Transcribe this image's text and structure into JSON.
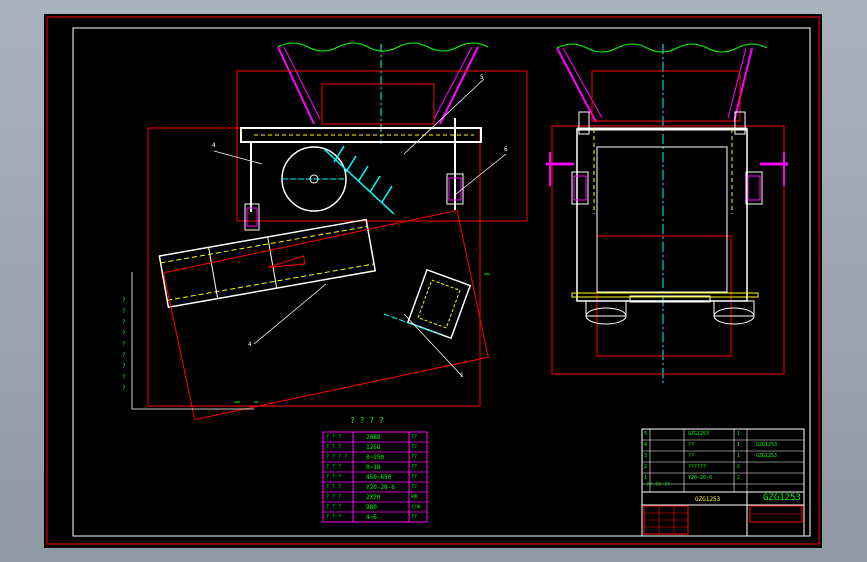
{
  "drawing": {
    "title_block_code": "GZG1253",
    "title_block_code2": "GZG1253",
    "name_cell": "GZG1253",
    "spec_heading": "? ? ? ?",
    "callouts": [
      "4",
      "5",
      "6",
      "4",
      "1"
    ]
  },
  "spec_table": {
    "rows": [
      {
        "label": "? ? ?",
        "value": "2088",
        "unit": "??"
      },
      {
        "label": "? ? ?",
        "value": "1250",
        "unit": "??"
      },
      {
        "label": "? ? ? ?",
        "value": "0~250",
        "unit": "??"
      },
      {
        "label": "? ? ?",
        "value": "0~18",
        "unit": "??"
      },
      {
        "label": "? ? ?",
        "value": "450~650",
        "unit": "??"
      },
      {
        "label": "? ? ?",
        "value": "Y20-20-6",
        "unit": "??"
      },
      {
        "label": "? ? ?",
        "value": "2X70",
        "unit": "kW"
      },
      {
        "label": "? ? ?",
        "value": "980",
        "unit": "r/m"
      },
      {
        "label": "? ? ?",
        "value": "4~6",
        "unit": "??"
      }
    ]
  },
  "bom_table": {
    "rows": [
      {
        "no": "5",
        "name": "GZG1253",
        "qty": "1",
        "code": ""
      },
      {
        "no": "4",
        "name": "??",
        "qty": "1",
        "code": "GZG1253"
      },
      {
        "no": "3",
        "name": "??",
        "qty": "1",
        "code": "GZG1253"
      },
      {
        "no": "2",
        "name": "??????",
        "qty": "2",
        "code": ""
      },
      {
        "no": "1",
        "name": "Y20-20-6",
        "qty": "2",
        "code": ""
      }
    ],
    "header": "?? ?? ??"
  },
  "left_side_labels": [
    "?",
    "?",
    "?",
    "?",
    "?",
    "?",
    "?",
    "?",
    "?"
  ],
  "colors": {
    "sheet_bg": "#000000",
    "frame": "#ff0000",
    "outline": "#ffffff",
    "machine_yellow": "#ffff00",
    "table_magenta": "#ff00ff",
    "text_green": "#00ff00",
    "axis_cyan": "#00ffff",
    "hopper_green": "#00ff00",
    "accent_red": "#ff0000"
  }
}
